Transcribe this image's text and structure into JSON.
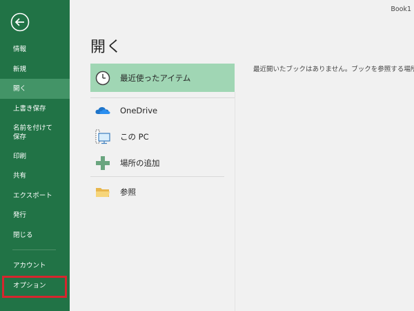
{
  "window": {
    "book_title": "Book1"
  },
  "sidebar": {
    "back_icon": "back-arrow-icon",
    "items": [
      {
        "label": "情報"
      },
      {
        "label": "新規"
      },
      {
        "label": "開く",
        "active": true
      },
      {
        "label": "上書き保存"
      },
      {
        "label": "名前を付けて",
        "label2": "保存"
      },
      {
        "label": "印刷"
      },
      {
        "label": "共有"
      },
      {
        "label": "エクスポート"
      },
      {
        "label": "発行"
      },
      {
        "label": "閉じる"
      },
      {
        "label": "アカウント"
      },
      {
        "label": "オプション"
      }
    ],
    "background_color": "#217346",
    "active_color": "#439467",
    "highlight_color": "#d6262e"
  },
  "main": {
    "title": "開く",
    "locations": [
      {
        "label": "最近使ったアイテム",
        "icon": "clock-icon"
      },
      {
        "label": "OneDrive",
        "icon": "cloud-icon"
      },
      {
        "label": "この PC",
        "icon": "computer-icon"
      },
      {
        "label": "場所の追加",
        "icon": "plus-icon"
      },
      {
        "label": "参照",
        "icon": "folder-icon"
      }
    ],
    "empty_message": "最近開いたブックはありません。ブックを参照する場所を選択してください"
  }
}
